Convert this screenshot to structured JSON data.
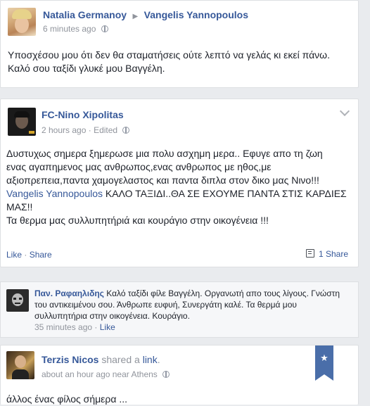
{
  "post1": {
    "author": "Natalia Germanoy",
    "target": "Vangelis Yannopoulos",
    "time": "6 minutes ago",
    "line1": "Υποσχέσου μου ότι δεν θα σταματήσεις ούτε λεπτό να γελάς κι εκεί πάνω.",
    "line2": "Καλό σου ταξίδι γλυκέ μου Βαγγέλη."
  },
  "post2": {
    "author": "FC-Nino Xipolitas",
    "time": "2 hours ago",
    "edited": "Edited",
    "line1": "Δυστυχως σημερα ξημερωσε μια πολυ ασχημη μερα.. Εφυγε απο τη ζωη",
    "line2": "ενας αγαπημενος μας ανθρωπος,ενας ανθρωπος με ηθος,με",
    "line3": "αξιοπρεπεια,παντα χαμογελαστος και παντα διπλα στον δικο μας Νινο!!!",
    "mention": "Vangelis Yannopoulos",
    "line4_rest": " ΚΑΛΟ ΤΑΞΙΔΙ..ΘΑ ΣΕ ΕΧΟΥΜΕ ΠΑΝΤΑ ΣΤΙΣ ΚΑΡΔΙΕΣ",
    "line5": "ΜΑΣ!!",
    "line6": "Τα θερμα μας συλλυπητήριά και κουράγιο στην οικογένεια !!!",
    "like_label": "Like",
    "sep": " · ",
    "share_label": "Share",
    "share_count": "1 Share"
  },
  "comment": {
    "author": "Παν. Ραφαηλιδης",
    "text_first": " Καλό ταξίδι φίλε Βαγγέλη. Οργανωτή απο τους λίγους. Γνώστη",
    "text_line2": "του αντικειμένου σου. Άνθρωπε ευφυή, Συνεργάτη καλέ. Τα θερμά μου",
    "text_line3": "συλλυπητήρια στην οικογένεια. Κουράγιο.",
    "time": "35 minutes ago",
    "sep": " · ",
    "like_label": "Like"
  },
  "post3": {
    "author": "Terzis Nicos",
    "shared_text": " shared a ",
    "link_text": "link",
    "dot": ".",
    "time": "about an hour ago near Athens",
    "text": "άλλος ένας φίλος σήμερα ..."
  },
  "colors": {
    "link": "#365899",
    "meta": "#90949c",
    "bookmark": "#4a6ea9"
  }
}
